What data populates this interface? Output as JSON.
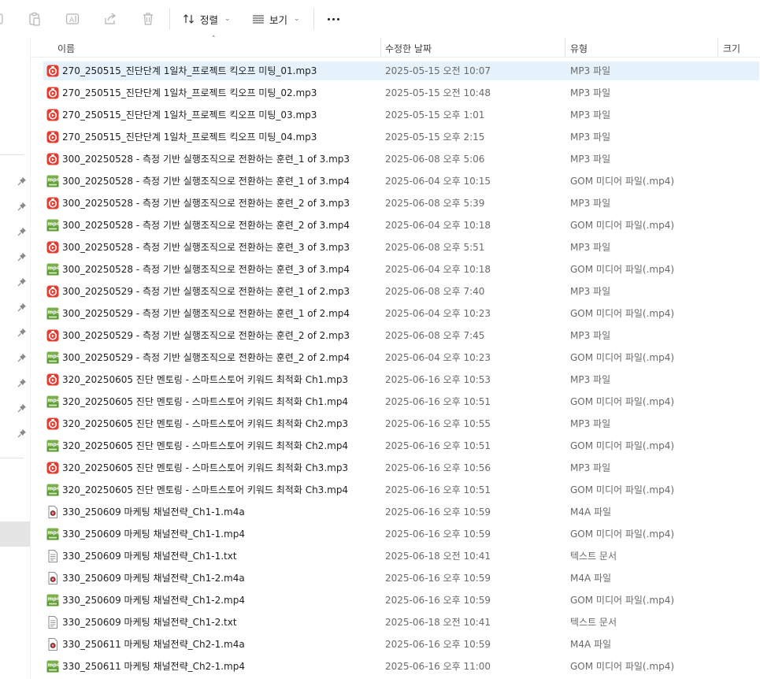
{
  "toolbar": {
    "sort_label": "정렬",
    "view_label": "보기"
  },
  "columns": {
    "name": "이름",
    "date": "수정한 날짜",
    "type": "유형",
    "size": "크기"
  },
  "files": [
    {
      "name": "270_250515_진단단계 1일차_프로젝트 킥오프 미팅_01.mp3",
      "date": "2025-05-15 오전 10:07",
      "type": "MP3 파일",
      "icon": "mp3-file-icon",
      "selected": true
    },
    {
      "name": "270_250515_진단단계 1일차_프로젝트 킥오프 미팅_02.mp3",
      "date": "2025-05-15 오전 10:48",
      "type": "MP3 파일",
      "icon": "mp3-file-icon"
    },
    {
      "name": "270_250515_진단단계 1일차_프로젝트 킥오프 미팅_03.mp3",
      "date": "2025-05-15 오후 1:01",
      "type": "MP3 파일",
      "icon": "mp3-file-icon"
    },
    {
      "name": "270_250515_진단단계 1일차_프로젝트 킥오프 미팅_04.mp3",
      "date": "2025-05-15 오후 2:15",
      "type": "MP3 파일",
      "icon": "mp3-file-icon"
    },
    {
      "name": "300_20250528 - 측정 기반 실행조직으로 전환하는 훈련_1 of 3.mp3",
      "date": "2025-06-08 오후 5:06",
      "type": "MP3 파일",
      "icon": "mp3-file-icon"
    },
    {
      "name": "300_20250528 - 측정 기반 실행조직으로 전환하는 훈련_1 of 3.mp4",
      "date": "2025-06-04 오후 10:15",
      "type": "GOM 미디어 파일(.mp4)",
      "icon": "mp4-file-icon"
    },
    {
      "name": "300_20250528 - 측정 기반 실행조직으로 전환하는 훈련_2 of 3.mp3",
      "date": "2025-06-08 오후 5:39",
      "type": "MP3 파일",
      "icon": "mp3-file-icon"
    },
    {
      "name": "300_20250528 - 측정 기반 실행조직으로 전환하는 훈련_2 of 3.mp4",
      "date": "2025-06-04 오후 10:18",
      "type": "GOM 미디어 파일(.mp4)",
      "icon": "mp4-file-icon"
    },
    {
      "name": "300_20250528 - 측정 기반 실행조직으로 전환하는 훈련_3 of 3.mp3",
      "date": "2025-06-08 오후 5:51",
      "type": "MP3 파일",
      "icon": "mp3-file-icon"
    },
    {
      "name": "300_20250528 - 측정 기반 실행조직으로 전환하는 훈련_3 of 3.mp4",
      "date": "2025-06-04 오후 10:18",
      "type": "GOM 미디어 파일(.mp4)",
      "icon": "mp4-file-icon"
    },
    {
      "name": "300_20250529 - 측정 기반 실행조직으로 전환하는 훈련_1 of 2.mp3",
      "date": "2025-06-08 오후 7:40",
      "type": "MP3 파일",
      "icon": "mp3-file-icon"
    },
    {
      "name": "300_20250529 - 측정 기반 실행조직으로 전환하는 훈련_1 of 2.mp4",
      "date": "2025-06-04 오후 10:23",
      "type": "GOM 미디어 파일(.mp4)",
      "icon": "mp4-file-icon"
    },
    {
      "name": "300_20250529 - 측정 기반 실행조직으로 전환하는 훈련_2 of 2.mp3",
      "date": "2025-06-08 오후 7:45",
      "type": "MP3 파일",
      "icon": "mp3-file-icon"
    },
    {
      "name": "300_20250529 - 측정 기반 실행조직으로 전환하는 훈련_2 of 2.mp4",
      "date": "2025-06-04 오후 10:23",
      "type": "GOM 미디어 파일(.mp4)",
      "icon": "mp4-file-icon"
    },
    {
      "name": "320_20250605 진단 멘토링 - 스마트스토어 키워드 최적화 Ch1.mp3",
      "date": "2025-06-16 오후 10:53",
      "type": "MP3 파일",
      "icon": "mp3-file-icon"
    },
    {
      "name": "320_20250605 진단 멘토링 - 스마트스토어 키워드 최적화 Ch1.mp4",
      "date": "2025-06-16 오후 10:51",
      "type": "GOM 미디어 파일(.mp4)",
      "icon": "mp4-file-icon"
    },
    {
      "name": "320_20250605 진단 멘토링 - 스마트스토어 키워드 최적화 Ch2.mp3",
      "date": "2025-06-16 오후 10:55",
      "type": "MP3 파일",
      "icon": "mp3-file-icon"
    },
    {
      "name": "320_20250605 진단 멘토링 - 스마트스토어 키워드 최적화 Ch2.mp4",
      "date": "2025-06-16 오후 10:51",
      "type": "GOM 미디어 파일(.mp4)",
      "icon": "mp4-file-icon"
    },
    {
      "name": "320_20250605 진단 멘토링 - 스마트스토어 키워드 최적화 Ch3.mp3",
      "date": "2025-06-16 오후 10:56",
      "type": "MP3 파일",
      "icon": "mp3-file-icon"
    },
    {
      "name": "320_20250605 진단 멘토링 - 스마트스토어 키워드 최적화 Ch3.mp4",
      "date": "2025-06-16 오후 10:51",
      "type": "GOM 미디어 파일(.mp4)",
      "icon": "mp4-file-icon"
    },
    {
      "name": "330_250609 마케팅 채널전략_Ch1-1.m4a",
      "date": "2025-06-16 오후 10:59",
      "type": "M4A 파일",
      "icon": "m4a-file-icon"
    },
    {
      "name": "330_250609 마케팅 채널전략_Ch1-1.mp4",
      "date": "2025-06-16 오후 10:59",
      "type": "GOM 미디어 파일(.mp4)",
      "icon": "mp4-file-icon"
    },
    {
      "name": "330_250609 마케팅 채널전략_Ch1-1.txt",
      "date": "2025-06-18 오전 10:41",
      "type": "텍스트 문서",
      "icon": "text-file-icon"
    },
    {
      "name": "330_250609 마케팅 채널전략_Ch1-2.m4a",
      "date": "2025-06-16 오후 10:59",
      "type": "M4A 파일",
      "icon": "m4a-file-icon"
    },
    {
      "name": "330_250609 마케팅 채널전략_Ch1-2.mp4",
      "date": "2025-06-16 오후 10:59",
      "type": "GOM 미디어 파일(.mp4)",
      "icon": "mp4-file-icon"
    },
    {
      "name": "330_250609 마케팅 채널전략_Ch1-2.txt",
      "date": "2025-06-18 오전 10:41",
      "type": "텍스트 문서",
      "icon": "text-file-icon"
    },
    {
      "name": "330_250611 마케팅 채널전략_Ch2-1.m4a",
      "date": "2025-06-16 오후 10:59",
      "type": "M4A 파일",
      "icon": "m4a-file-icon"
    },
    {
      "name": "330_250611 마케팅 채널전략_Ch2-1.mp4",
      "date": "2025-06-16 오후 11:00",
      "type": "GOM 미디어 파일(.mp4)",
      "icon": "mp4-file-icon"
    }
  ]
}
